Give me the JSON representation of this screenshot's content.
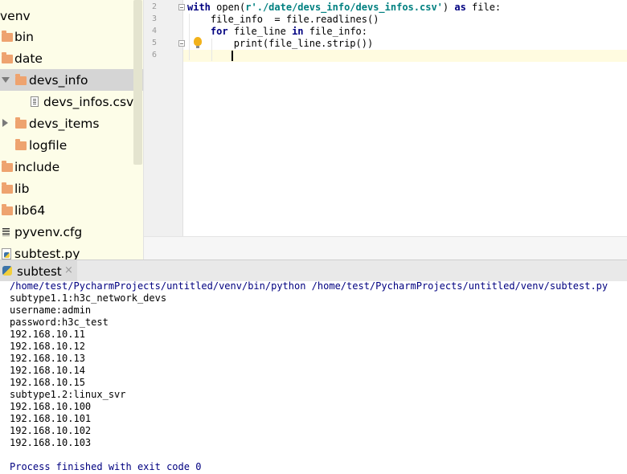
{
  "project_tree": {
    "root": "venv",
    "items": [
      {
        "label": "bin",
        "kind": "folder"
      },
      {
        "label": "date",
        "kind": "folder"
      },
      {
        "label": "devs_info",
        "kind": "folder",
        "expanded": true,
        "selected": true
      },
      {
        "label": "devs_infos.csv",
        "kind": "csv-file"
      },
      {
        "label": "devs_items",
        "kind": "folder",
        "collapsed": true
      },
      {
        "label": "logfile",
        "kind": "folder"
      },
      {
        "label": "include",
        "kind": "folder"
      },
      {
        "label": "lib",
        "kind": "folder"
      },
      {
        "label": "lib64",
        "kind": "folder-link"
      },
      {
        "label": "pyvenv.cfg",
        "kind": "cfg-file"
      },
      {
        "label": "subtest.py",
        "kind": "python-file"
      }
    ]
  },
  "editor": {
    "line_numbers": [
      "2",
      "3",
      "4",
      "5",
      "6"
    ],
    "lines": [
      {
        "parts": [
          {
            "t": "with",
            "c": "kw"
          },
          {
            "t": " open(",
            "c": ""
          },
          {
            "t": "r'./date/devs_info/devs_infos.csv'",
            "c": "str"
          },
          {
            "t": ") ",
            "c": ""
          },
          {
            "t": "as",
            "c": "kw"
          },
          {
            "t": " file:",
            "c": ""
          }
        ]
      },
      {
        "parts": [
          {
            "t": "    file_info  = file.readlines()",
            "c": ""
          }
        ]
      },
      {
        "parts": [
          {
            "t": "    ",
            "c": ""
          },
          {
            "t": "for",
            "c": "kw"
          },
          {
            "t": " file_line ",
            "c": ""
          },
          {
            "t": "in",
            "c": "kw"
          },
          {
            "t": " file_info:",
            "c": ""
          }
        ]
      },
      {
        "parts": [
          {
            "t": "        print(file_line.strip())",
            "c": ""
          }
        ]
      },
      {
        "parts": [
          {
            "t": "",
            "c": ""
          }
        ]
      }
    ]
  },
  "run_panel": {
    "tab_label": "subtest",
    "close_glyph": "×",
    "console": [
      {
        "text": "/home/test/PycharmProjects/untitled/venv/bin/python /home/test/PycharmProjects/untitled/venv/subtest.py",
        "kind": "cmd"
      },
      {
        "text": "subtype1.1:h3c_network_devs",
        "kind": "out"
      },
      {
        "text": "username:admin",
        "kind": "out"
      },
      {
        "text": "password:h3c_test",
        "kind": "out"
      },
      {
        "text": "192.168.10.11",
        "kind": "out"
      },
      {
        "text": "192.168.10.12",
        "kind": "out"
      },
      {
        "text": "192.168.10.13",
        "kind": "out"
      },
      {
        "text": "192.168.10.14",
        "kind": "out"
      },
      {
        "text": "192.168.10.15",
        "kind": "out"
      },
      {
        "text": "subtype1.2:linux_svr",
        "kind": "out"
      },
      {
        "text": "192.168.10.100",
        "kind": "out"
      },
      {
        "text": "192.168.10.101",
        "kind": "out"
      },
      {
        "text": "192.168.10.102",
        "kind": "out"
      },
      {
        "text": "192.168.10.103",
        "kind": "out"
      },
      {
        "text": "",
        "kind": "out"
      },
      {
        "text": "Process finished with exit code 0",
        "kind": "exit"
      }
    ]
  },
  "colors": {
    "tree_background": "#fdfde8",
    "keyword": "#000080",
    "string": "#008080",
    "folder": "#eea36f",
    "selection": "#d5d5d5"
  }
}
